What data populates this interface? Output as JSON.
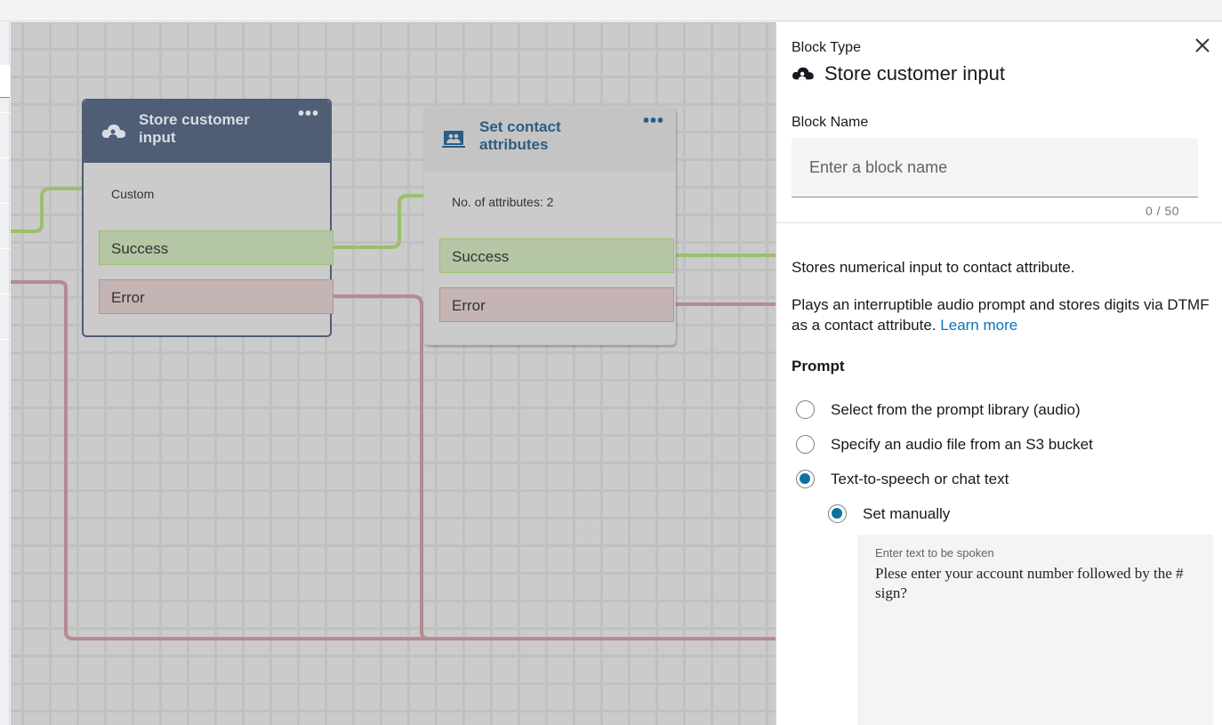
{
  "canvas": {
    "blocks": [
      {
        "id": "store-customer-input",
        "title": "Store customer input",
        "icon": "cloud-user-icon",
        "menu": "•••",
        "body_text": "Custom",
        "branches": [
          "Success",
          "Error"
        ],
        "header_color": "#4f5d75"
      },
      {
        "id": "set-contact-attributes",
        "title": "Set contact attributes",
        "icon": "contact-card-icon",
        "menu": "•••",
        "body_text": "No. of attributes: 2",
        "branches": [
          "Success",
          "Error"
        ],
        "title_color": "#2b5c84"
      }
    ],
    "connector_colors": {
      "success": "#9bc06d",
      "error": "#b58b91"
    }
  },
  "panel": {
    "block_type_label": "Block Type",
    "block_type": "Store customer input",
    "block_name_label": "Block Name",
    "block_name_value": "",
    "block_name_placeholder": "Enter a block name",
    "block_name_counter": "0 / 50",
    "description_short": "Stores numerical input to contact attribute.",
    "description_long": "Plays an interruptible audio prompt and stores digits via DTMF as a contact attribute.",
    "learn_more": "Learn more",
    "prompt_heading": "Prompt",
    "prompt_options": [
      {
        "label": "Select from the prompt library (audio)",
        "selected": false
      },
      {
        "label": "Specify an audio file from an S3 bucket",
        "selected": false
      },
      {
        "label": "Text-to-speech or chat text",
        "selected": true
      }
    ],
    "tts_sub_option": {
      "label": "Set manually",
      "selected": true
    },
    "tts_field_label": "Enter text to be spoken",
    "tts_text": "Plese enter your account number followed by the # sign?",
    "accent_color": "#0a73a3",
    "link_color": "#0a73bb"
  }
}
